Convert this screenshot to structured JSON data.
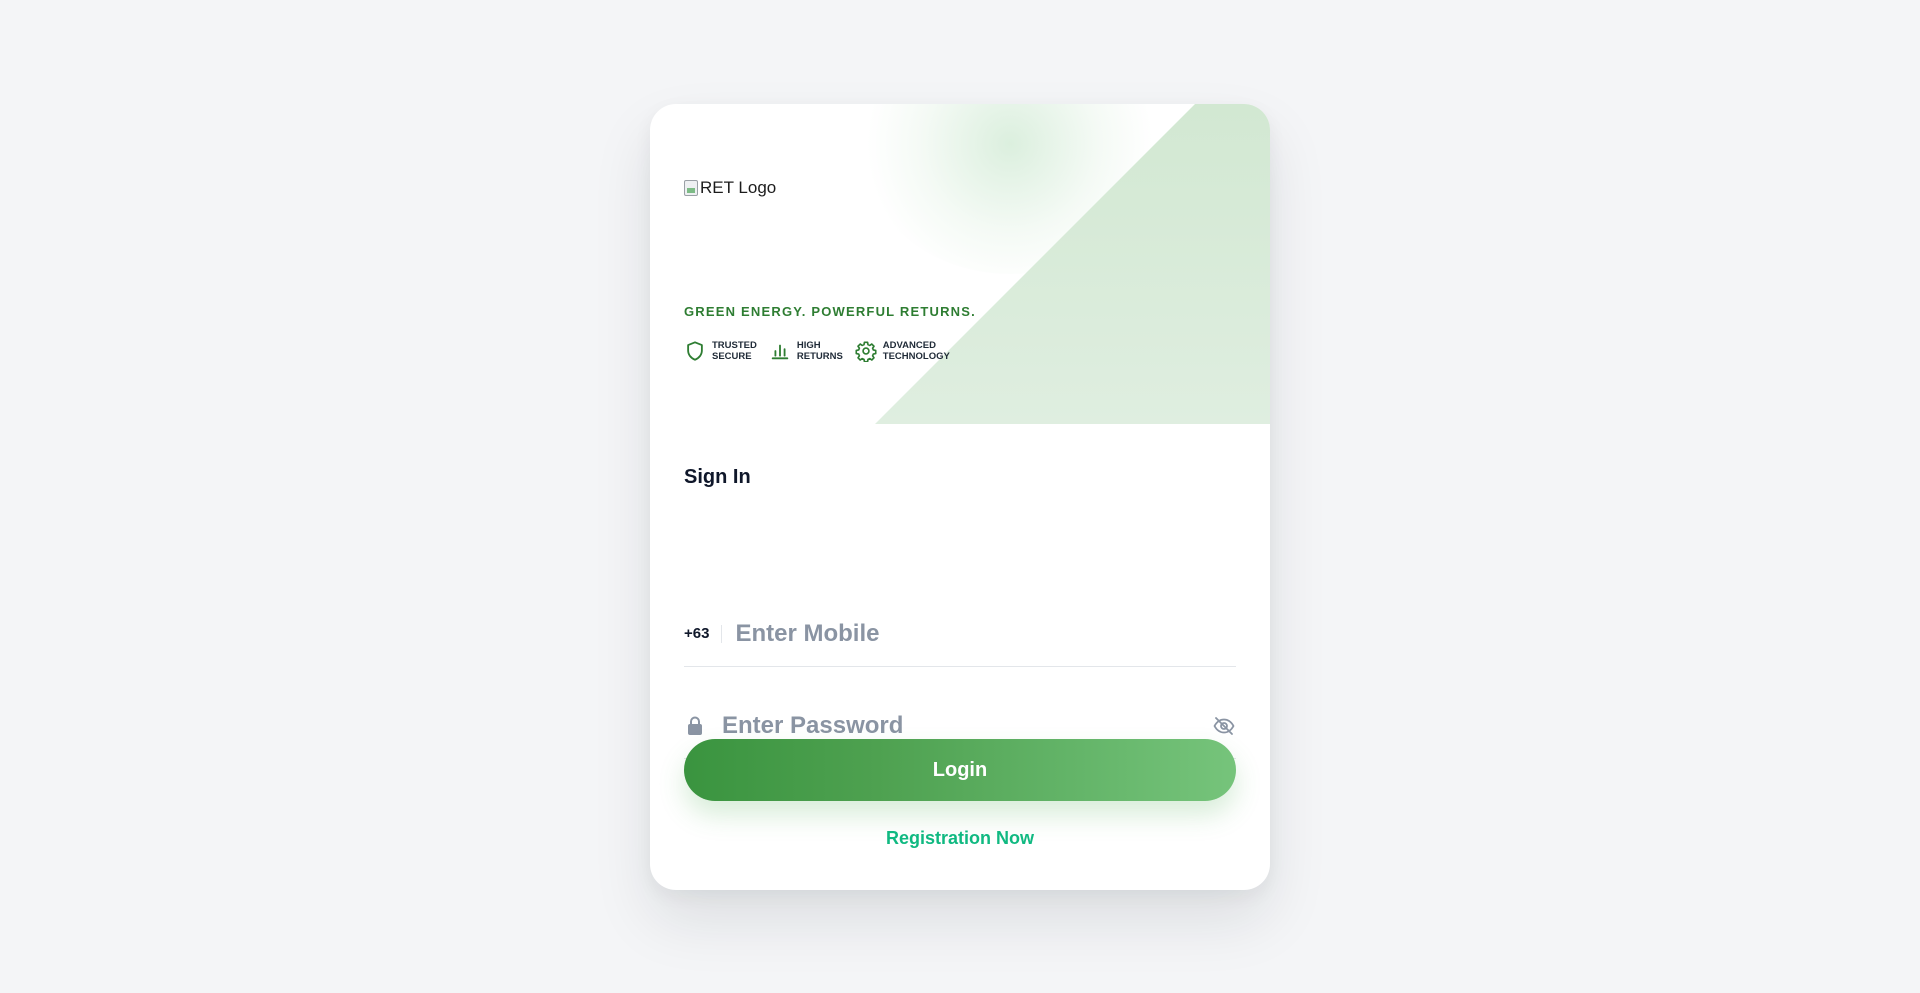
{
  "logo": {
    "alt_text": "RET Logo"
  },
  "hero": {
    "tagline": "GREEN ENERGY. POWERFUL RETURNS.",
    "features": [
      {
        "icon": "shield-icon",
        "line1": "TRUSTED",
        "line2": "SECURE"
      },
      {
        "icon": "bar-chart-icon",
        "line1": "HIGH",
        "line2": "RETURNS"
      },
      {
        "icon": "gear-icon",
        "line1": "ADVANCED",
        "line2": "TECHNOLOGY"
      }
    ]
  },
  "form": {
    "title": "Sign In",
    "country_code": "+63",
    "mobile_placeholder": "Enter Mobile",
    "mobile_value": "",
    "password_placeholder": "Enter Password",
    "password_value": "",
    "login_label": "Login",
    "register_label": "Registration Now"
  },
  "colors": {
    "page_background": "#f4f5f7",
    "brand_green": "#2e7d32",
    "button_start": "#3a943f",
    "button_end": "#76c47b",
    "link_green": "#10b981",
    "placeholder_gray": "#8a94a3"
  }
}
